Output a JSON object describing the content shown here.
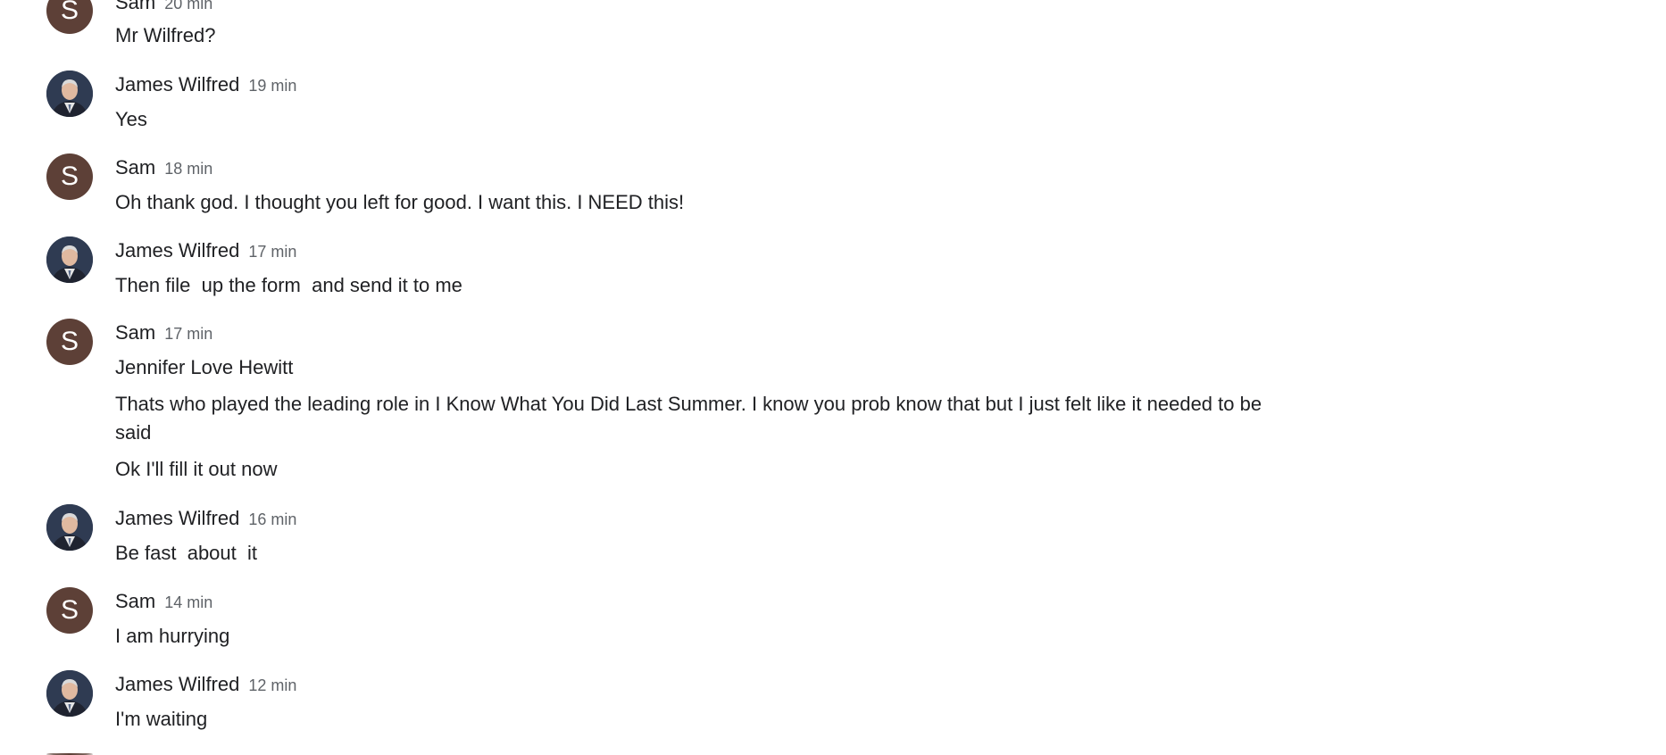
{
  "messages": [
    {
      "sender": "Sam",
      "avatar_letter": "S",
      "time": "20 min",
      "lines": [
        "Mr Wilfred?"
      ]
    },
    {
      "sender": "James Wilfred",
      "time": "19 min",
      "lines": [
        "Yes"
      ]
    },
    {
      "sender": "Sam",
      "avatar_letter": "S",
      "time": "18 min",
      "lines": [
        "Oh thank god. I thought you left for good. I want this. I NEED this!"
      ]
    },
    {
      "sender": "James Wilfred",
      "time": "17 min",
      "lines": [
        "Then file  up the form  and send it to me"
      ]
    },
    {
      "sender": "Sam",
      "avatar_letter": "S",
      "time": "17 min",
      "lines": [
        "Jennifer Love Hewitt",
        "Thats who played the leading role in I Know What You Did Last Summer. I know you prob know that but I just felt like it needed to be said",
        "Ok I'll fill it out now"
      ]
    },
    {
      "sender": "James Wilfred",
      "time": "16 min",
      "lines": [
        "Be fast  about  it"
      ]
    },
    {
      "sender": "Sam",
      "avatar_letter": "S",
      "time": "14 min",
      "lines": [
        "I am hurrying"
      ]
    },
    {
      "sender": "James Wilfred",
      "time": "12 min",
      "lines": [
        "I'm waiting"
      ]
    }
  ],
  "colors": {
    "sam_avatar": "#5d4037",
    "james_avatar": "#2f3b52",
    "name_text": "#202124",
    "time_text": "#5f6368"
  },
  "icons": {
    "james_avatar": "profile-photo-icon"
  }
}
